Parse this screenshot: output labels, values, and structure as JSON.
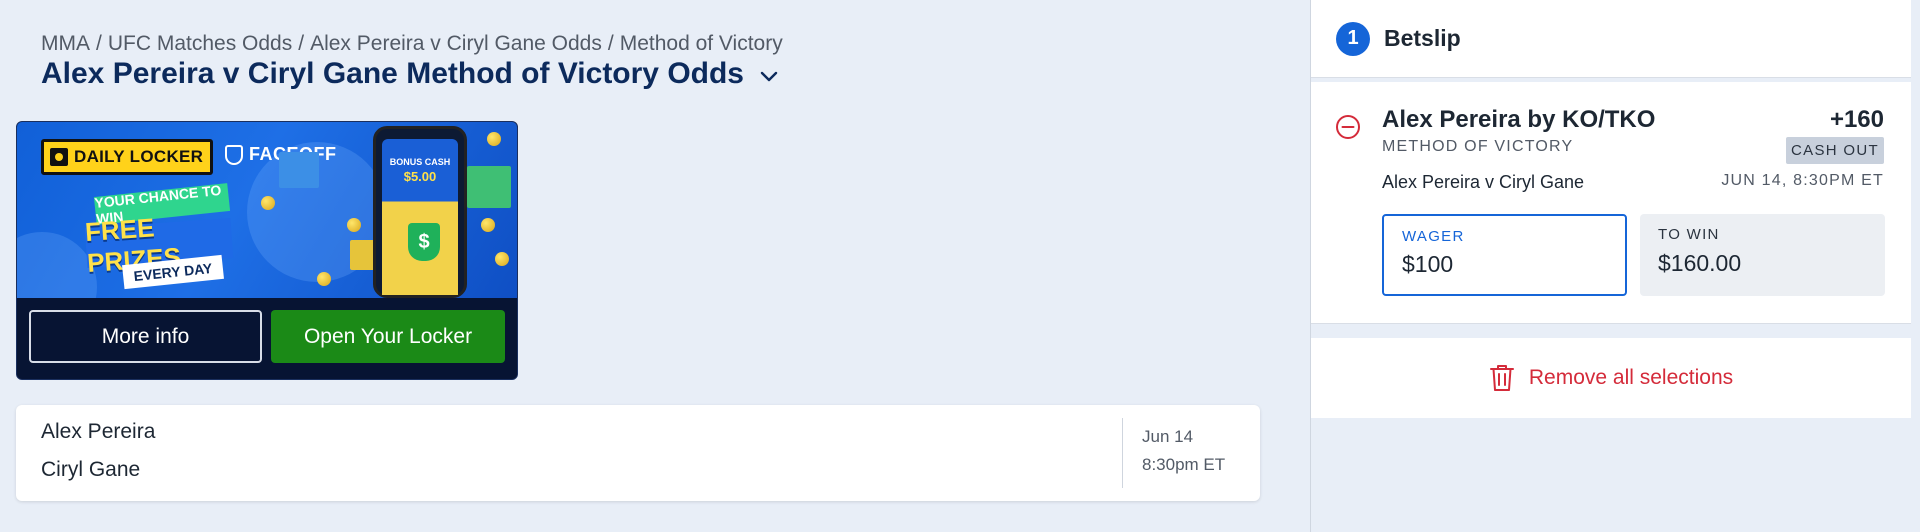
{
  "breadcrumb": {
    "items": [
      "MMA",
      "UFC Matches Odds",
      "Alex Pereira v Ciryl Gane Odds",
      "Method of Victory"
    ],
    "separator": "/"
  },
  "page": {
    "title": "Alex Pereira v Ciryl Gane Method of Victory Odds"
  },
  "promo": {
    "brand_primary": "DAILY LOCKER",
    "brand_secondary": "FACEOFF",
    "tagline_top": "YOUR CHANCE TO WIN",
    "tagline_main": "FREE PRIZES",
    "tagline_bottom": "EVERY DAY",
    "phone_label": "BONUS CASH",
    "phone_amount": "$5.00",
    "more_info_label": "More info",
    "open_locker_label": "Open Your Locker",
    "colors": {
      "accent_yellow": "#ffd21a",
      "button_green": "#1b8a17"
    }
  },
  "event": {
    "fighters": [
      "Alex Pereira",
      "Ciryl Gane"
    ],
    "date": "Jun 14",
    "time": "8:30pm ET"
  },
  "betslip": {
    "count": "1",
    "title": "Betslip",
    "selection": {
      "name": "Alex Pereira by KO/TKO",
      "market": "METHOD OF VICTORY",
      "odds": "+160",
      "cash_out_label": "CASH OUT",
      "event_name": "Alex Pereira v Ciryl Gane",
      "event_datetime": "JUN 14, 8:30PM ET",
      "wager_label": "WAGER",
      "wager_value": "$100",
      "to_win_label": "TO WIN",
      "to_win_value": "$160.00"
    },
    "remove_all_label": "Remove all selections",
    "colors": {
      "primary_blue": "#1565d8",
      "danger_red": "#d42b3a"
    }
  },
  "icons": [
    "chevron-down-icon",
    "remove-circle-icon",
    "trash-icon",
    "lock-icon",
    "shield-icon"
  ]
}
